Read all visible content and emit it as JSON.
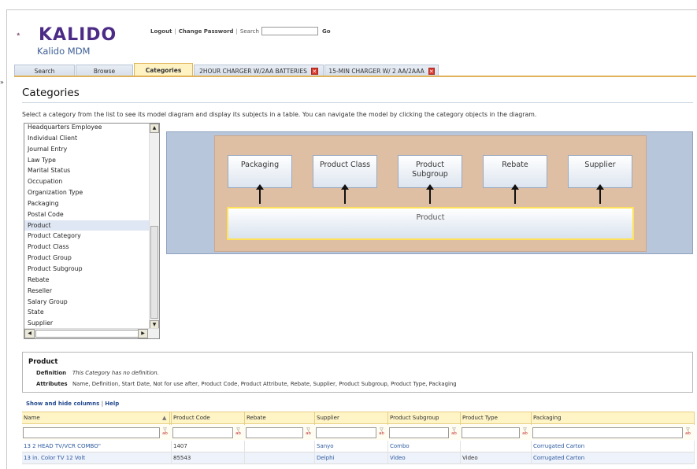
{
  "app": {
    "brand": "KALIDO",
    "subtitle": "Kalido MDM",
    "logout": "Logout",
    "change_password": "Change Password",
    "search_label": "Search",
    "go": "Go",
    "brand_color": "#4c2b86"
  },
  "tabs": [
    {
      "label": "Search"
    },
    {
      "label": "Browse"
    },
    {
      "label": "Categories"
    },
    {
      "label": "2HOUR CHARGER W/2AA BATTERIES"
    },
    {
      "label": "15-MIN CHARGER W/ 2 AA/2AAA"
    }
  ],
  "page": {
    "title": "Categories",
    "instructions": "Select a category from the list to see its model diagram and display its subjects in a table. You can navigate the model by clicking the category objects in the diagram."
  },
  "category_list": [
    "Headquarters Employee",
    "Individual Client",
    "Journal Entry",
    "Law Type",
    "Marital Status",
    "Occupation",
    "Organization Type",
    "Packaging",
    "Postal Code",
    "Product",
    "Product Category",
    "Product Class",
    "Product Group",
    "Product Subgroup",
    "Rebate",
    "Reseller",
    "Salary Group",
    "State",
    "Supplier"
  ],
  "selected_category": "Product",
  "diagram": {
    "boxes": [
      "Packaging",
      "Product Class",
      "Product Subgroup",
      "Rebate",
      "Supplier"
    ],
    "center": "Product"
  },
  "details": {
    "title": "Product",
    "definition_label": "Definition",
    "definition_value": "This Category has no definition.",
    "attributes_label": "Attributes",
    "attributes_value": "Name, Definition, Start Date, Not for use after, Product Code, Product Attribute, Rebate, Supplier, Product Subgroup, Product Type, Packaging"
  },
  "grid": {
    "show_hide": "Show and hide columns",
    "help": "Help",
    "columns": [
      "Name",
      "Product Code",
      "Rebate",
      "Supplier",
      "Product Subgroup",
      "Product Type",
      "Packaging"
    ],
    "rows": [
      [
        "13 2 HEAD TV/VCR COMBO\"",
        "1407",
        "",
        "Sanyo",
        "Combo",
        "",
        "Corrugated Carton"
      ],
      [
        "13 in. Color TV 12 Volt",
        "85543",
        "",
        "Delphi",
        "Video",
        "Video",
        "Corrugated Carton"
      ]
    ]
  }
}
